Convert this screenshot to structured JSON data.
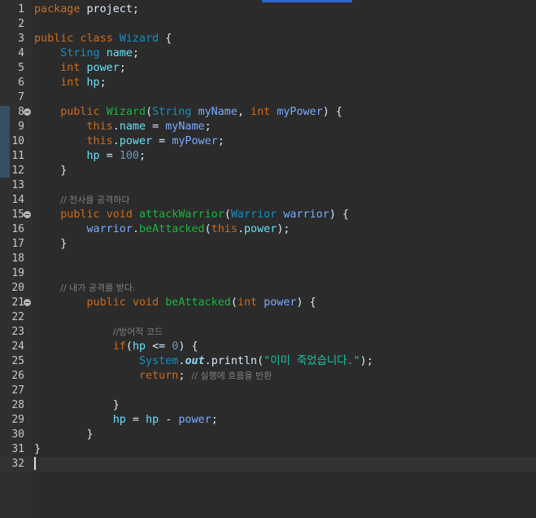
{
  "editor": {
    "language": "java",
    "current_line": 32,
    "change_bar_lines": [
      8,
      12
    ],
    "colors": {
      "background": "#2b2b2b",
      "keyword": "#cc6c1d",
      "type": "#1290c3",
      "method": "#1eb540",
      "variable": "#79abff",
      "field": "#66e1f8",
      "number": "#6897bb",
      "string": "#17c6a3",
      "comment": "#808080"
    },
    "lines": [
      {
        "n": "1",
        "fold": false,
        "tokens": [
          [
            "kw",
            "package"
          ],
          [
            "plain",
            " project;"
          ]
        ]
      },
      {
        "n": "2",
        "fold": false,
        "tokens": []
      },
      {
        "n": "3",
        "fold": false,
        "tokens": [
          [
            "kw",
            "public"
          ],
          [
            "plain",
            " "
          ],
          [
            "kw",
            "class"
          ],
          [
            "plain",
            " "
          ],
          [
            "type",
            "Wizard"
          ],
          [
            "plain",
            " {"
          ]
        ]
      },
      {
        "n": "4",
        "fold": false,
        "tokens": [
          [
            "plain",
            "    "
          ],
          [
            "type",
            "String"
          ],
          [
            "plain",
            " "
          ],
          [
            "field",
            "name"
          ],
          [
            "plain",
            ";"
          ]
        ]
      },
      {
        "n": "5",
        "fold": false,
        "tokens": [
          [
            "plain",
            "    "
          ],
          [
            "kw",
            "int"
          ],
          [
            "plain",
            " "
          ],
          [
            "field",
            "power"
          ],
          [
            "plain",
            ";"
          ]
        ]
      },
      {
        "n": "6",
        "fold": false,
        "tokens": [
          [
            "plain",
            "    "
          ],
          [
            "kw",
            "int"
          ],
          [
            "plain",
            " "
          ],
          [
            "field",
            "hp"
          ],
          [
            "plain",
            ";"
          ]
        ]
      },
      {
        "n": "7",
        "fold": false,
        "tokens": []
      },
      {
        "n": "8",
        "fold": true,
        "tokens": [
          [
            "plain",
            "    "
          ],
          [
            "kw",
            "public"
          ],
          [
            "plain",
            " "
          ],
          [
            "fn",
            "Wizard"
          ],
          [
            "plain",
            "("
          ],
          [
            "type",
            "String"
          ],
          [
            "plain",
            " "
          ],
          [
            "var",
            "myName"
          ],
          [
            "plain",
            ", "
          ],
          [
            "kw",
            "int"
          ],
          [
            "plain",
            " "
          ],
          [
            "var",
            "myPower"
          ],
          [
            "plain",
            ") {"
          ]
        ]
      },
      {
        "n": "9",
        "fold": false,
        "tokens": [
          [
            "plain",
            "        "
          ],
          [
            "kw",
            "this"
          ],
          [
            "plain",
            "."
          ],
          [
            "field",
            "name"
          ],
          [
            "plain",
            " = "
          ],
          [
            "var",
            "myName"
          ],
          [
            "plain",
            ";"
          ]
        ]
      },
      {
        "n": "10",
        "fold": false,
        "tokens": [
          [
            "plain",
            "        "
          ],
          [
            "kw",
            "this"
          ],
          [
            "plain",
            "."
          ],
          [
            "field",
            "power"
          ],
          [
            "plain",
            " = "
          ],
          [
            "var",
            "myPower"
          ],
          [
            "plain",
            ";"
          ]
        ]
      },
      {
        "n": "11",
        "fold": false,
        "tokens": [
          [
            "plain",
            "        "
          ],
          [
            "field",
            "hp"
          ],
          [
            "plain",
            " = "
          ],
          [
            "num",
            "100"
          ],
          [
            "plain",
            ";"
          ]
        ]
      },
      {
        "n": "12",
        "fold": false,
        "tokens": [
          [
            "plain",
            "    }"
          ]
        ]
      },
      {
        "n": "13",
        "fold": false,
        "tokens": []
      },
      {
        "n": "14",
        "fold": false,
        "tokens": [
          [
            "plain",
            "    "
          ],
          [
            "cmt",
            "// 전사를 공격하다"
          ]
        ]
      },
      {
        "n": "15",
        "fold": true,
        "tokens": [
          [
            "plain",
            "    "
          ],
          [
            "kw",
            "public"
          ],
          [
            "plain",
            " "
          ],
          [
            "kw",
            "void"
          ],
          [
            "plain",
            " "
          ],
          [
            "fn",
            "attackWarrior"
          ],
          [
            "plain",
            "("
          ],
          [
            "type",
            "Warrior"
          ],
          [
            "plain",
            " "
          ],
          [
            "var",
            "warrior"
          ],
          [
            "plain",
            ") {"
          ]
        ]
      },
      {
        "n": "16",
        "fold": false,
        "tokens": [
          [
            "plain",
            "        "
          ],
          [
            "var",
            "warrior"
          ],
          [
            "plain",
            "."
          ],
          [
            "fn",
            "beAttacked"
          ],
          [
            "plain",
            "("
          ],
          [
            "kw",
            "this"
          ],
          [
            "plain",
            "."
          ],
          [
            "field",
            "power"
          ],
          [
            "plain",
            ");"
          ]
        ]
      },
      {
        "n": "17",
        "fold": false,
        "tokens": [
          [
            "plain",
            "    }"
          ]
        ]
      },
      {
        "n": "18",
        "fold": false,
        "tokens": []
      },
      {
        "n": "19",
        "fold": false,
        "tokens": []
      },
      {
        "n": "20",
        "fold": false,
        "tokens": [
          [
            "plain",
            "    "
          ],
          [
            "cmt",
            "// 내가 공격를 받다."
          ]
        ]
      },
      {
        "n": "21",
        "fold": true,
        "tokens": [
          [
            "plain",
            "        "
          ],
          [
            "kw",
            "public"
          ],
          [
            "plain",
            " "
          ],
          [
            "kw",
            "void"
          ],
          [
            "plain",
            " "
          ],
          [
            "fn",
            "beAttacked"
          ],
          [
            "plain",
            "("
          ],
          [
            "kw",
            "int"
          ],
          [
            "plain",
            " "
          ],
          [
            "var",
            "power"
          ],
          [
            "plain",
            ") {"
          ]
        ]
      },
      {
        "n": "22",
        "fold": false,
        "tokens": []
      },
      {
        "n": "23",
        "fold": false,
        "tokens": [
          [
            "plain",
            "            "
          ],
          [
            "cmt",
            "//방어적 코드"
          ]
        ]
      },
      {
        "n": "24",
        "fold": false,
        "tokens": [
          [
            "plain",
            "            "
          ],
          [
            "kw",
            "if"
          ],
          [
            "plain",
            "("
          ],
          [
            "field",
            "hp"
          ],
          [
            "plain",
            " <= "
          ],
          [
            "num",
            "0"
          ],
          [
            "plain",
            ") {"
          ]
        ]
      },
      {
        "n": "25",
        "fold": false,
        "tokens": [
          [
            "plain",
            "                "
          ],
          [
            "type",
            "System"
          ],
          [
            "plain",
            "."
          ],
          [
            "out",
            "out"
          ],
          [
            "plain",
            "."
          ],
          [
            "plain",
            "println("
          ],
          [
            "str",
            "\"이미 죽었습니다.\""
          ],
          [
            "plain",
            ");"
          ]
        ]
      },
      {
        "n": "26",
        "fold": false,
        "tokens": [
          [
            "plain",
            "                "
          ],
          [
            "kw",
            "return"
          ],
          [
            "plain",
            "; "
          ],
          [
            "cmt",
            "// 실행에 흐름을 반환"
          ]
        ]
      },
      {
        "n": "27",
        "fold": false,
        "tokens": []
      },
      {
        "n": "28",
        "fold": false,
        "tokens": [
          [
            "plain",
            "            }"
          ]
        ]
      },
      {
        "n": "29",
        "fold": false,
        "tokens": [
          [
            "plain",
            "            "
          ],
          [
            "field",
            "hp"
          ],
          [
            "plain",
            " = "
          ],
          [
            "field",
            "hp"
          ],
          [
            "plain",
            " - "
          ],
          [
            "var",
            "power"
          ],
          [
            "plain",
            ";"
          ]
        ]
      },
      {
        "n": "30",
        "fold": false,
        "tokens": [
          [
            "plain",
            "        }"
          ]
        ]
      },
      {
        "n": "31",
        "fold": false,
        "tokens": [
          [
            "plain",
            "}"
          ]
        ]
      },
      {
        "n": "32",
        "fold": false,
        "tokens": []
      }
    ]
  }
}
